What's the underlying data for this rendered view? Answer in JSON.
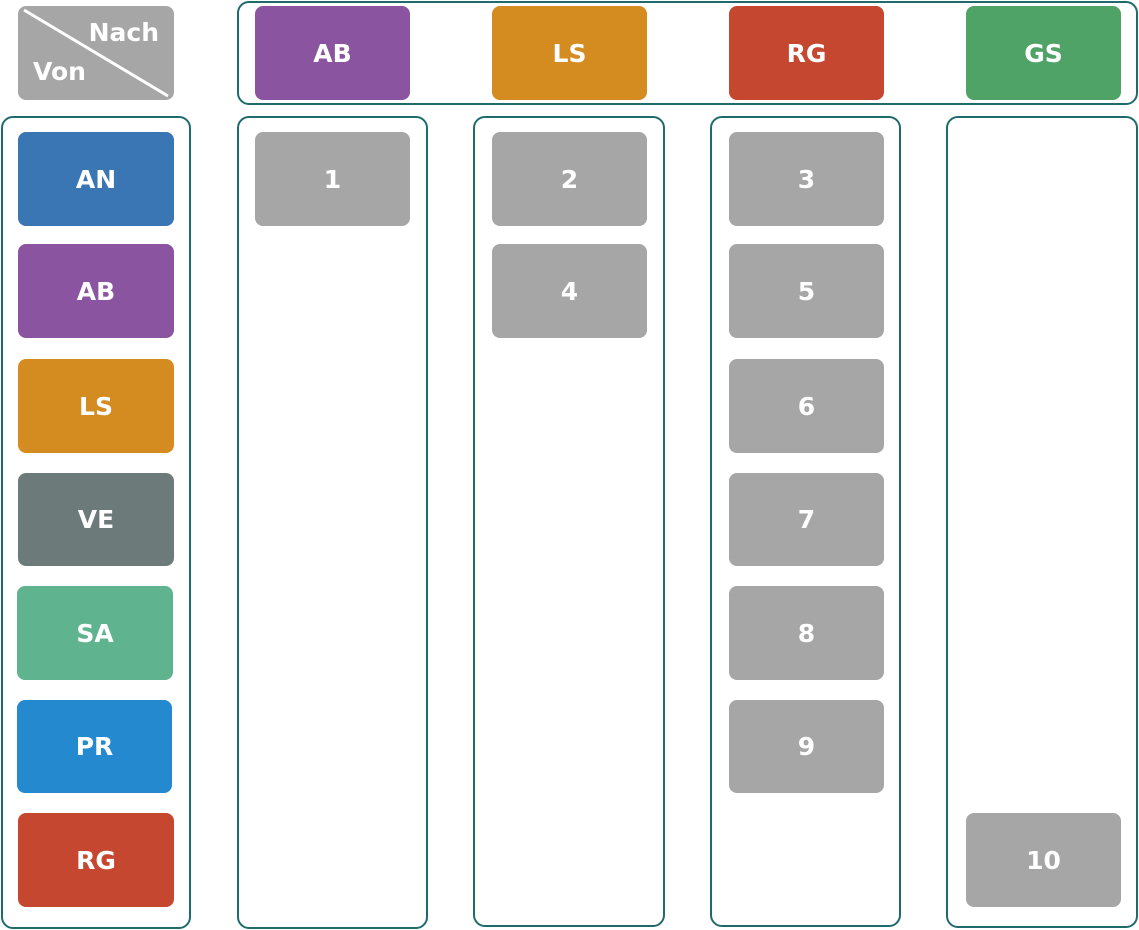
{
  "corner": {
    "to_label": "Nach",
    "from_label": "Von",
    "color": "#a6a6a6"
  },
  "to_columns": [
    {
      "label": "AB",
      "color": "#8b54a0"
    },
    {
      "label": "LS",
      "color": "#d48b20"
    },
    {
      "label": "RG",
      "color": "#c5472f"
    },
    {
      "label": "GS",
      "color": "#4fa366"
    }
  ],
  "from_rows": [
    {
      "label": "AN",
      "color": "#3b76b4"
    },
    {
      "label": "AB",
      "color": "#8b54a0"
    },
    {
      "label": "LS",
      "color": "#d48b20"
    },
    {
      "label": "VE",
      "color": "#6d7a7a"
    },
    {
      "label": "SA",
      "color": "#5fb38f"
    },
    {
      "label": "PR",
      "color": "#2589d0"
    },
    {
      "label": "RG",
      "color": "#c5472f"
    }
  ],
  "transitions": [
    {
      "label": "1",
      "from": "AN",
      "to": "AB"
    },
    {
      "label": "2",
      "from": "AN",
      "to": "LS"
    },
    {
      "label": "3",
      "from": "AN",
      "to": "RG"
    },
    {
      "label": "4",
      "from": "AB",
      "to": "LS"
    },
    {
      "label": "5",
      "from": "AB",
      "to": "RG"
    },
    {
      "label": "6",
      "from": "LS",
      "to": "RG"
    },
    {
      "label": "7",
      "from": "VE",
      "to": "RG"
    },
    {
      "label": "8",
      "from": "SA",
      "to": "RG"
    },
    {
      "label": "9",
      "from": "PR",
      "to": "RG"
    },
    {
      "label": "10",
      "from": "RG",
      "to": "GS"
    }
  ],
  "transition_color": "#a6a6a6",
  "border_color": "#1f6b6b"
}
